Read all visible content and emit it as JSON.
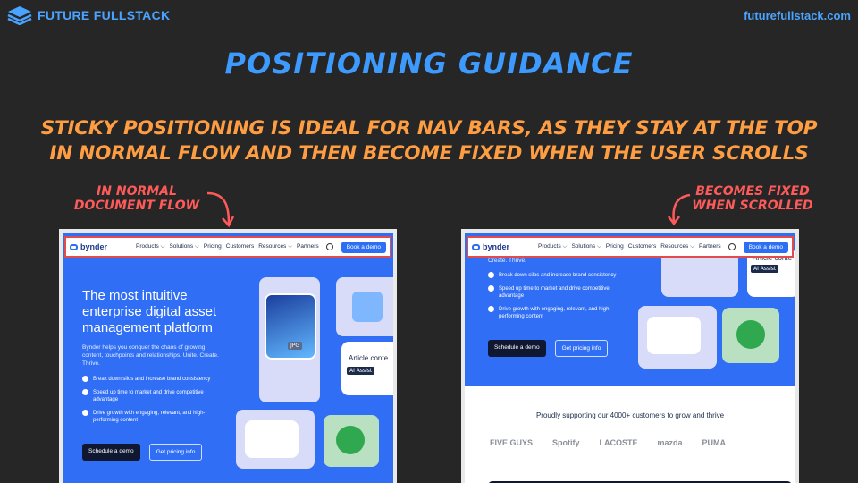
{
  "header": {
    "brand": "FUTURE FULLSTACK",
    "site": "futurefullstack.com"
  },
  "title": "POSITIONING GUIDANCE",
  "subtitle_line1": "STICKY POSITIONING IS IDEAL FOR NAV BARS, AS THEY STAY AT THE TOP",
  "subtitle_line2": "IN NORMAL FLOW AND THEN BECOME FIXED WHEN THE USER SCROLLS",
  "annotations": {
    "left_line1": "IN NORMAL",
    "left_line2": "DOCUMENT FLOW",
    "right_line1": "BECOMES FIXED",
    "right_line2": "WHEN SCROLLED"
  },
  "nav": {
    "brand": "bynder",
    "links": [
      "Products ⌵",
      "Solutions ⌵",
      "Pricing",
      "Customers",
      "Resources ⌵",
      "Partners"
    ],
    "cta": "Book a demo"
  },
  "hero": {
    "heading": "The most intuitive enterprise digital asset management platform",
    "body": "Bynder helps you conquer the chaos of growing content, touchpoints and relationships. Unite. Create. Thrive.",
    "body_tail": "Create. Thrive.",
    "bullets": [
      "Break down silos and increase brand consistency",
      "Speed up time to market and drive competitive advantage",
      "Drive growth with engaging, relevant, and high-performing content"
    ],
    "primary_btn": "Schedule a demo",
    "secondary_btn": "Get pricing info",
    "card_jpg": "JPG",
    "card_article": "Article conte",
    "card_ai": "AI Assist"
  },
  "customers": {
    "headline": "Proudly supporting our 4000+ customers to grow and thrive",
    "logos": [
      "FIVE GUYS",
      "Spotify",
      "LACOSTE",
      "mazda",
      "PUMA"
    ]
  },
  "colors": {
    "bg": "#262626",
    "title": "#3d9bff",
    "subtitle": "#ff9d42",
    "annotation": "#ff5a5a",
    "bynder_blue": "#2f6ef5"
  }
}
